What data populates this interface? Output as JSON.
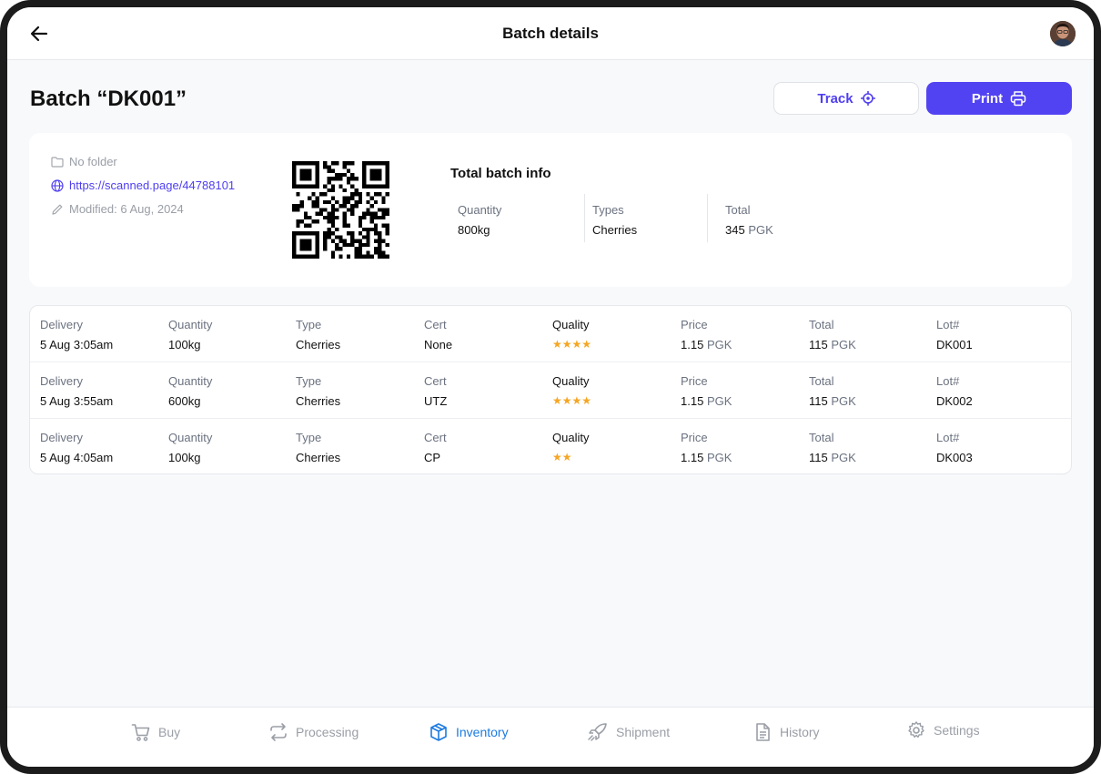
{
  "header": {
    "title": "Batch details",
    "back_icon": "arrow-left-icon",
    "avatar_icon": "user-avatar"
  },
  "page": {
    "title": "Batch “DK001”",
    "track_label": "Track",
    "print_label": "Print"
  },
  "batch_info": {
    "folder": "No folder",
    "link": "https://scanned.page/44788101",
    "modified": "Modified: 6 Aug, 2024",
    "section_title": "Total batch info",
    "quantity_label": "Quantity",
    "quantity_value": "800kg",
    "types_label": "Types",
    "types_value": "Cherries",
    "total_label": "Total",
    "total_value": "345",
    "total_unit": "PGK"
  },
  "deliveries": {
    "labels": {
      "delivery": "Delivery",
      "quantity": "Quantity",
      "type": "Type",
      "cert": "Cert",
      "quality": "Quality",
      "price": "Price",
      "total": "Total",
      "lot": "Lot#"
    },
    "unit": "PGK",
    "rows": [
      {
        "delivery": "5 Aug 3:05am",
        "quantity": "100kg",
        "type": "Cherries",
        "cert": "None",
        "quality_stars": 4,
        "quality_text": "★★★★",
        "price": "1.15",
        "total": "115",
        "lot": "DK001"
      },
      {
        "delivery": "5 Aug 3:55am",
        "quantity": "600kg",
        "type": "Cherries",
        "cert": "UTZ",
        "quality_stars": 4,
        "quality_text": "★★★★",
        "price": "1.15",
        "total": "115",
        "lot": "DK002"
      },
      {
        "delivery": "5 Aug 4:05am",
        "quantity": "100kg",
        "type": "Cherries",
        "cert": "CP",
        "quality_stars": 2,
        "quality_text": "★★",
        "price": "1.15",
        "total": "115",
        "lot": "DK003"
      }
    ]
  },
  "nav": {
    "items": [
      {
        "label": "Buy",
        "icon": "cart-icon"
      },
      {
        "label": "Processing",
        "icon": "repeat-icon"
      },
      {
        "label": "Inventory",
        "icon": "box-icon",
        "active": true
      },
      {
        "label": "Shipment",
        "icon": "rocket-icon"
      },
      {
        "label": "History",
        "icon": "document-icon"
      },
      {
        "label": "Settings",
        "icon": "gear-icon"
      }
    ]
  },
  "colors": {
    "accent": "#5243f2",
    "nav_active": "#1d7be0",
    "star": "#f5a623"
  }
}
